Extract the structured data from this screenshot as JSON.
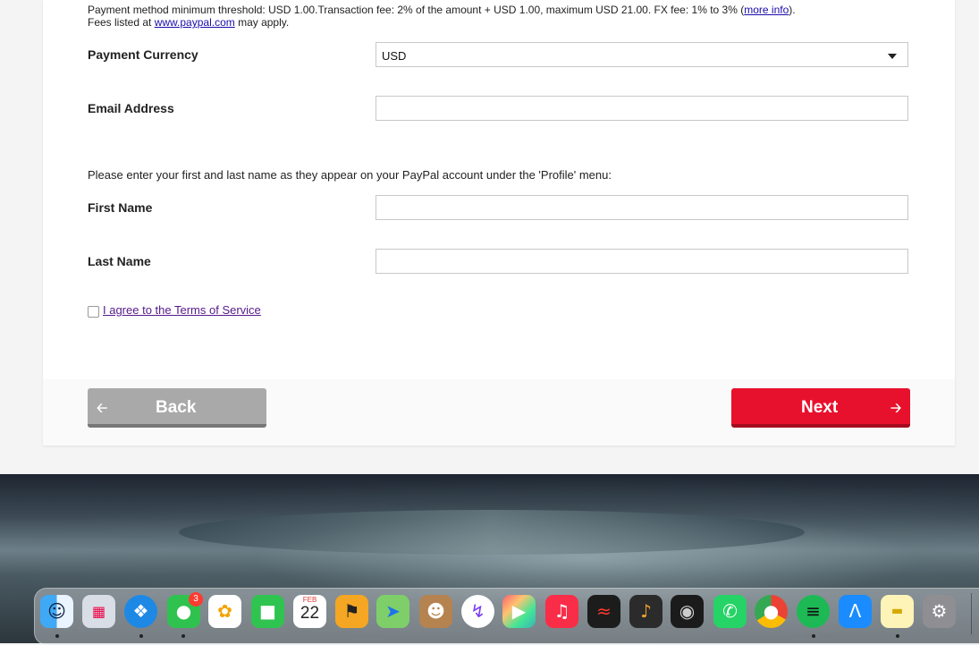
{
  "form": {
    "threshold_text": "Payment method minimum threshold: USD 1.00.Transaction fee: 2% of the amount + USD 1.00, maximum USD 21.00. FX fee: 1% to 3% (",
    "more_info_link": "more info",
    "threshold_close": ").",
    "fees_prefix": "Fees listed at ",
    "fees_link": "www.paypal.com",
    "fees_suffix": " may apply.",
    "currency_label": "Payment Currency",
    "currency_value": "USD",
    "email_label": "Email Address",
    "email_value": "",
    "name_instructions": "Please enter your first and last name as they appear on your PayPal account under the 'Profile' menu:",
    "first_name_label": "First Name",
    "first_name_value": "",
    "last_name_label": "Last Name",
    "last_name_value": "",
    "tos_label": "I agree to the Terms of Service",
    "tos_checked": false
  },
  "buttons": {
    "back_label": "Back",
    "next_label": "Next",
    "back_color": "#a9a9a9",
    "next_color": "#e8112d"
  },
  "dock": {
    "messages_badge": "3",
    "calendar_month": "FEB",
    "calendar_day": "22",
    "apps": [
      "finder-icon",
      "launchpad-icon",
      "safari-icon",
      "messages-icon",
      "photos-icon",
      "facetime-icon",
      "calendar-icon",
      "garageband-stage-icon",
      "maps-icon",
      "contacts-icon",
      "messenger-icon",
      "final-cut-pro-icon",
      "music-icon",
      "voice-memos-icon",
      "guitar-icon",
      "logic-icon",
      "whatsapp-icon",
      "chrome-icon",
      "spotify-icon",
      "app-store-icon",
      "notes-icon",
      "system-settings-icon"
    ]
  }
}
